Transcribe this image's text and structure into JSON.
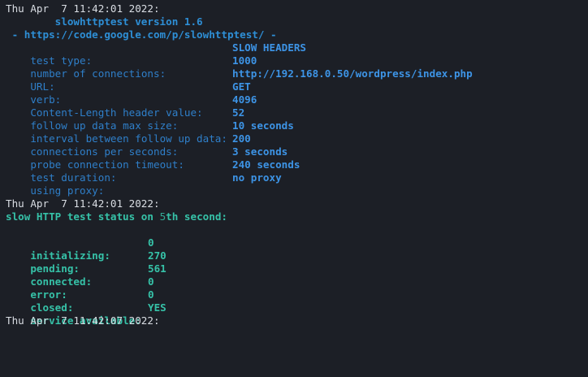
{
  "timestamps": {
    "first": "Thu Apr  7 11:42:01 2022:",
    "second": "Thu Apr  7 11:42:01 2022:",
    "third": "Thu Apr  7 11:42:07 2022:"
  },
  "banner": {
    "version": "        slowhttptest version 1.6",
    "url": " - https://code.google.com/p/slowhttptest/ -"
  },
  "config": [
    {
      "label": "test type:",
      "value": "SLOW HEADERS"
    },
    {
      "label": "number of connections:",
      "value": "1000"
    },
    {
      "label": "URL:",
      "value": "http://192.168.0.50/wordpress/index.php"
    },
    {
      "label": "verb:",
      "value": "GET"
    },
    {
      "label": "Content-Length header value:",
      "value": "4096"
    },
    {
      "label": "follow up data max size:",
      "value": "52"
    },
    {
      "label": "interval between follow up data:",
      "value": "10 seconds"
    },
    {
      "label": "connections per seconds:",
      "value": "200"
    },
    {
      "label": "probe connection timeout:",
      "value": "3 seconds"
    },
    {
      "label": "test duration:",
      "value": "240 seconds"
    },
    {
      "label": "using proxy:",
      "value": "no proxy"
    }
  ],
  "status": {
    "header_prefix": "slow HTTP test status on ",
    "second_number": "5",
    "header_suffix": "th second:",
    "items": [
      {
        "label": "initializing:",
        "value": "0"
      },
      {
        "label": "pending:",
        "value": "270"
      },
      {
        "label": "connected:",
        "value": "561"
      },
      {
        "label": "error:",
        "value": "0"
      },
      {
        "label": "closed:",
        "value": "0"
      },
      {
        "label": "service available:",
        "value": "YES"
      }
    ]
  },
  "colors": {
    "background": "#1c1f26",
    "timestamp": "#d9dde3",
    "config_label": "#2f7fc9",
    "config_value": "#3d94e6",
    "status": "#36c2a8"
  }
}
